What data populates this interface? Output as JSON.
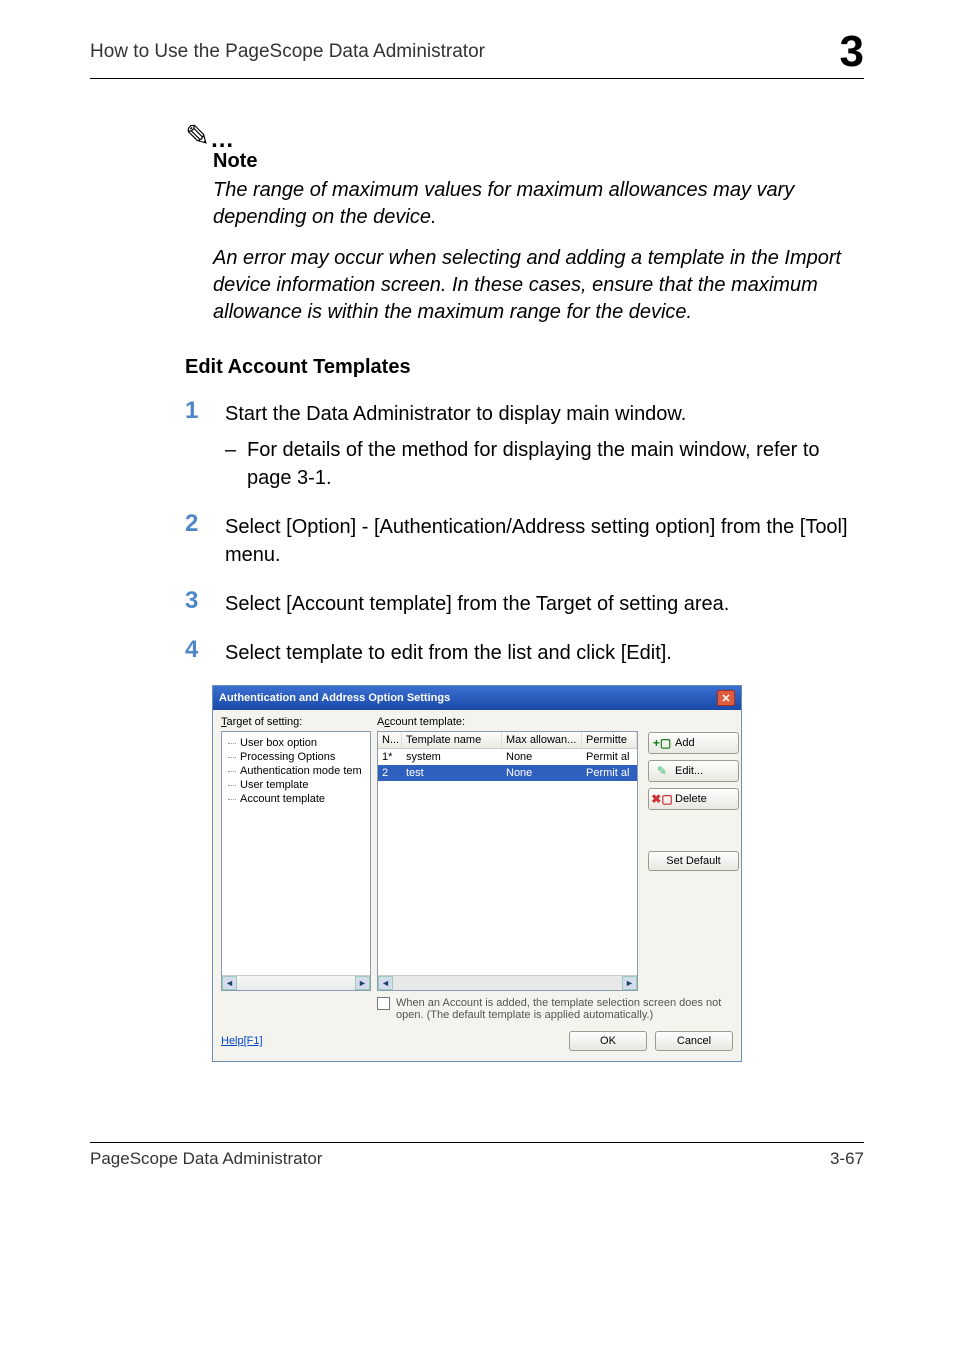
{
  "header": {
    "title": "How to Use the PageScope Data Administrator",
    "chapter_number": "3"
  },
  "note": {
    "label": "Note",
    "paragraph1": "The range of maximum values for maximum allowances may vary depending on the device.",
    "paragraph2": "An error may occur when selecting and adding a template in the Import device information screen. In these cases, ensure that the maximum allowance is within the maximum range for the device."
  },
  "section_heading": "Edit Account Templates",
  "steps": {
    "s1": {
      "num": "1",
      "text": "Start the Data Administrator to display main window.",
      "sub": "For details of the method for displaying the main window, refer to page 3-1."
    },
    "s2": {
      "num": "2",
      "text": "Select [Option] - [Authentication/Address setting option] from the [Tool] menu."
    },
    "s3": {
      "num": "3",
      "text": "Select [Account template] from the Target of setting area."
    },
    "s4": {
      "num": "4",
      "text": "Select template to edit from the list and click [Edit]."
    }
  },
  "dialog": {
    "title": "Authentication and Address Option Settings",
    "target_label": "Target of setting:",
    "tree": {
      "i1": "User box option",
      "i2": "Processing Options",
      "i3": "Authentication mode tem",
      "i4": "User template",
      "i5": "Account template"
    },
    "table_label": "Account template:",
    "columns": {
      "c1": "N...",
      "c2": "Template name",
      "c3": "Max allowan...",
      "c4": "Permitte"
    },
    "rows": {
      "r1": {
        "n": "1*",
        "name": "system",
        "max": "None",
        "perm": "Permit al"
      },
      "r2": {
        "n": "2",
        "name": "test",
        "max": "None",
        "perm": "Permit al"
      }
    },
    "buttons": {
      "add": "Add",
      "edit": "Edit...",
      "delete": "Delete",
      "set_default": "Set Default"
    },
    "footnote": "When an Account is added, the template selection screen does not open. (The default template is applied automatically.)",
    "help": "Help[F1]",
    "ok": "OK",
    "cancel": "Cancel"
  },
  "footer": {
    "product": "PageScope Data Administrator",
    "page": "3-67"
  }
}
